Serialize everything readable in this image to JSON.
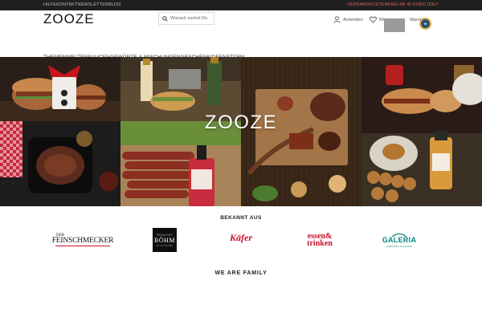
{
  "topbar": {
    "links": [
      "HILFE",
      "KONTAKT",
      "NEWSLETTER",
      "BLOG"
    ],
    "shipping": "VERSANDKOSTENFREI AB 40 EURO (DE)*"
  },
  "header": {
    "logo": "ZOOZE",
    "search_placeholder": "Wonach suchst Du",
    "account_label": "Anmelden",
    "wishlist_label": "Wu",
    "cart_label": "Warenk"
  },
  "nav": [
    "THEMENWELTEN",
    "SAUCEN",
    "GEWÜRZE & MISCHUNGEN",
    "GESCHENKIDEEN",
    "STORY"
  ],
  "hero": {
    "title": "ZOOZE"
  },
  "press": {
    "heading": "BEKANNT AUS",
    "logos": {
      "feinschmecker_top": "DER",
      "feinschmecker": "FEINSCHMECKER",
      "feinkost_top": "FEINKOST",
      "bohm": "BÖHM",
      "bohm_sub": "STUTTGART",
      "kafer": "Käfer",
      "essen_1": "essen&",
      "essen_2": "trinken",
      "galeria": "GALERIA",
      "galeria_sub": "KARSTADT KAUFHOF"
    }
  },
  "family": {
    "heading": "WE ARE FAMILY"
  },
  "colors": {
    "accent": "#e0655a",
    "topbar": "#1f1f1f",
    "essen": "#c8102e",
    "galeria": "#00857c"
  },
  "icons": [
    "search-icon",
    "user-icon",
    "heart-icon",
    "cart-icon"
  ]
}
